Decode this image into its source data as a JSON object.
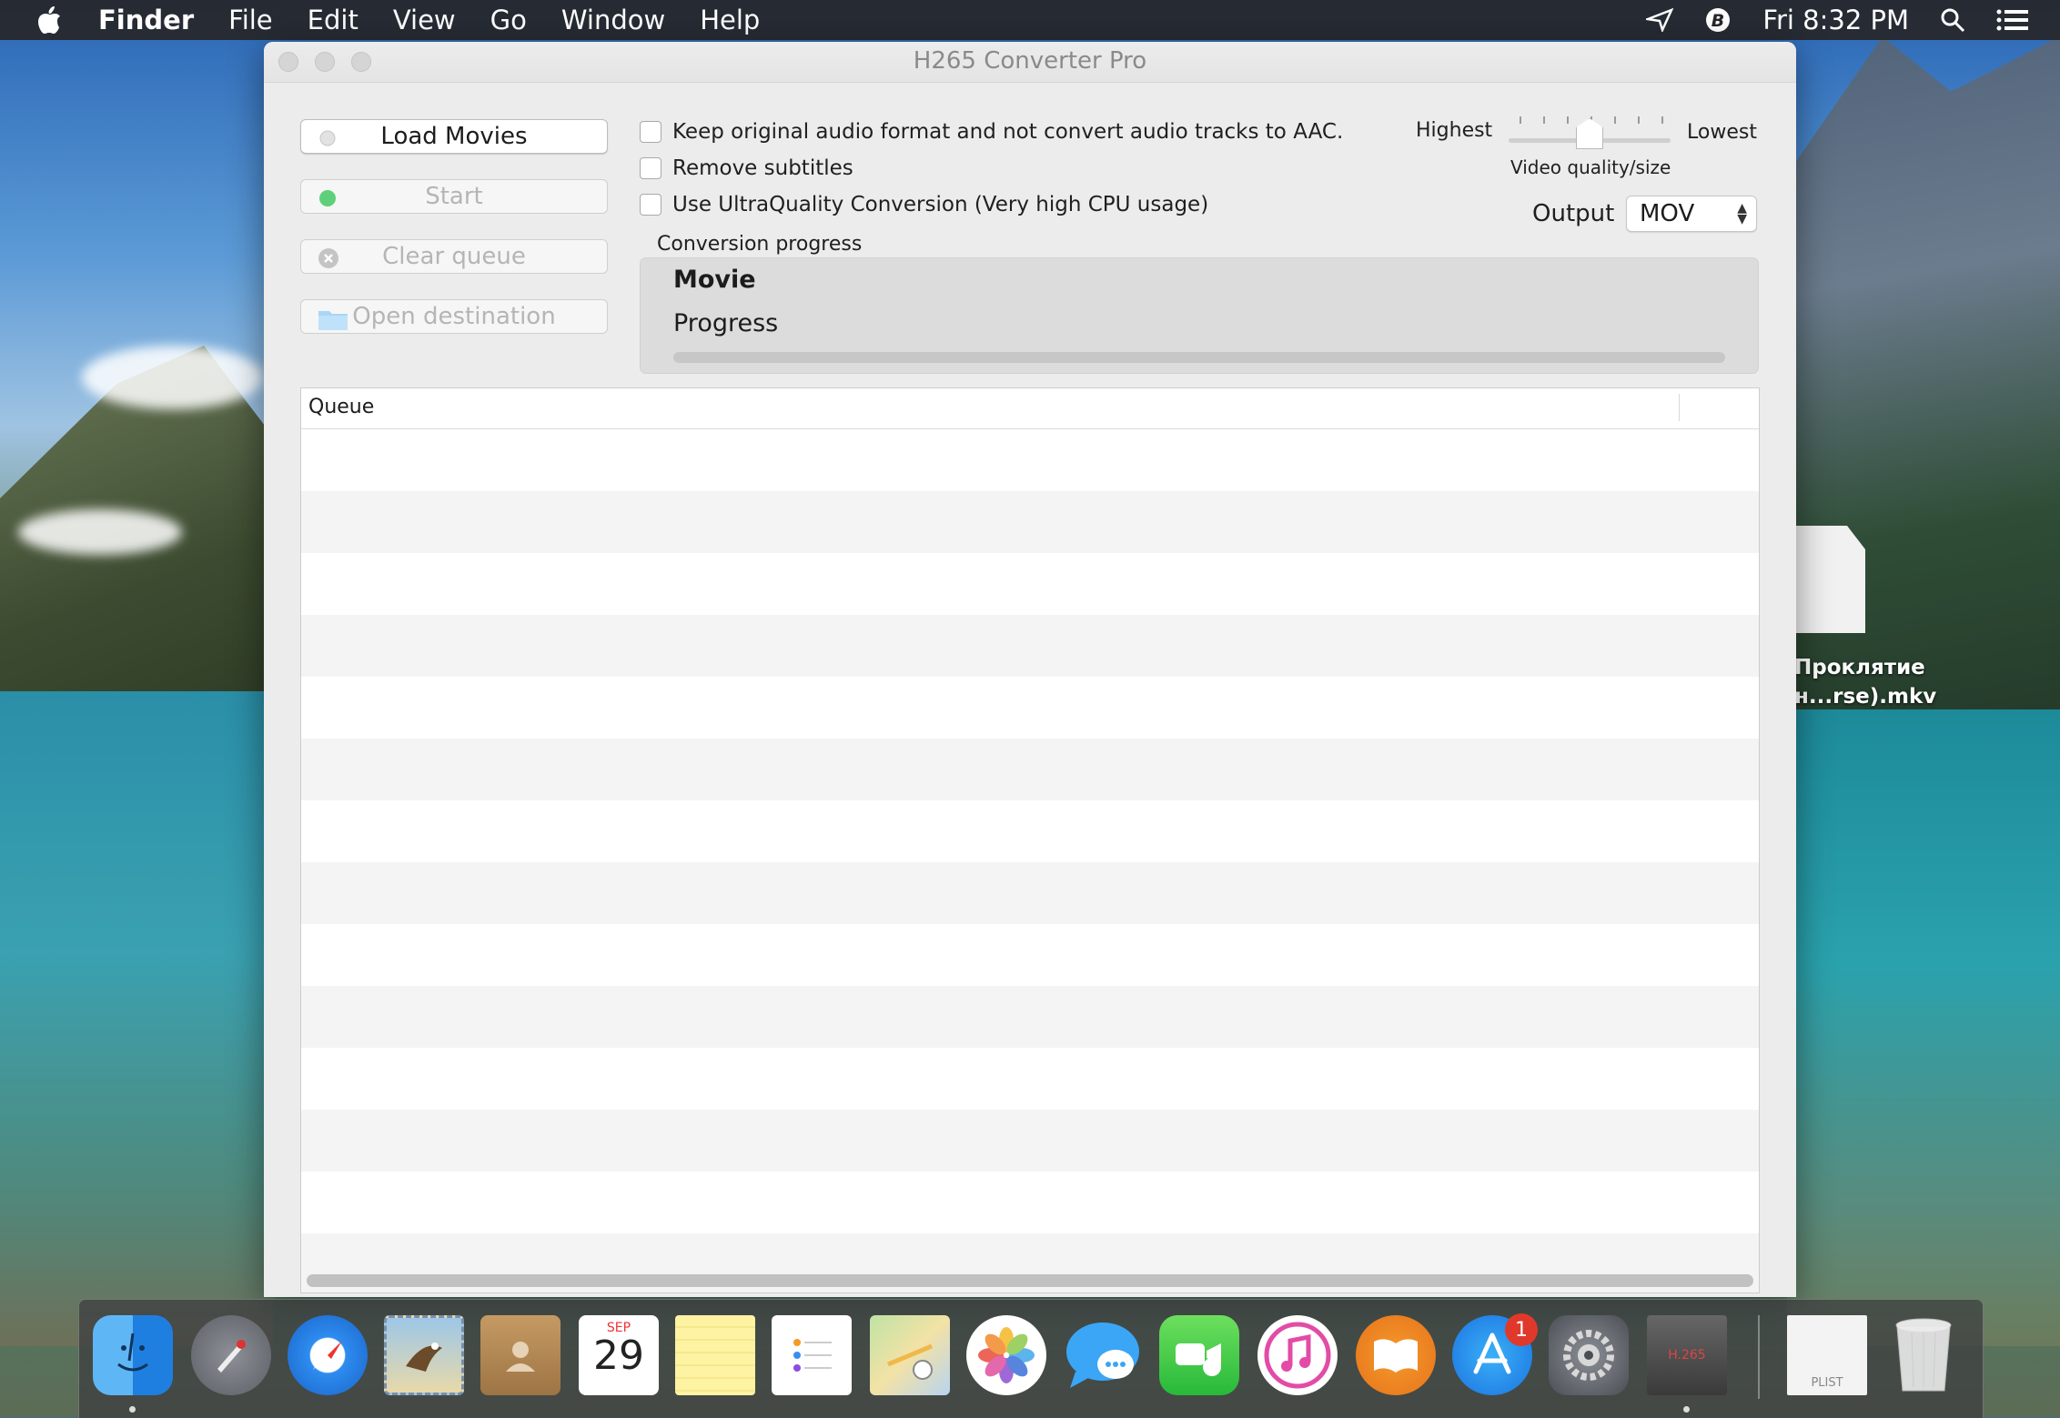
{
  "menubar": {
    "app_name": "Finder",
    "items": [
      "File",
      "Edit",
      "View",
      "Go",
      "Window",
      "Help"
    ],
    "clock": "Fri 8:32 PM"
  },
  "desktop": {
    "file_label_line1": "Проклятие",
    "file_label_line2": "н...rse).mkv"
  },
  "window": {
    "title": "H265 Converter Pro",
    "buttons": {
      "load": "Load Movies",
      "start": "Start",
      "clear": "Clear queue",
      "open_dest": "Open destination"
    },
    "options": {
      "keep_audio": "Keep original audio format and not convert audio tracks to AAC.",
      "remove_subs": "Remove subtitles",
      "ultra": "Use UltraQuality Conversion (Very high CPU usage)"
    },
    "quality": {
      "highest": "Highest",
      "lowest": "Lowest",
      "caption": "Video quality/size",
      "level": 0.5
    },
    "output": {
      "label": "Output",
      "selected": "MOV"
    },
    "progress": {
      "title": "Conversion progress",
      "movie_label": "Movie",
      "progress_label": "Progress",
      "value": 0
    },
    "queue": {
      "header": "Queue",
      "row_count": 14
    }
  },
  "dock": {
    "calendar_month": "SEP",
    "calendar_day": "29",
    "appstore_badge": "1",
    "plist_label": "PLIST",
    "h265_label": "H.265",
    "apps": [
      "finder-icon",
      "launchpad-icon",
      "safari-icon",
      "mail-icon",
      "contacts-icon",
      "calendar-icon",
      "notes-icon",
      "reminders-icon",
      "maps-icon",
      "photos-icon",
      "messages-icon",
      "facetime-icon",
      "itunes-icon",
      "ibooks-icon",
      "app-store-icon",
      "system-preferences-icon",
      "h265-converter-icon"
    ]
  }
}
